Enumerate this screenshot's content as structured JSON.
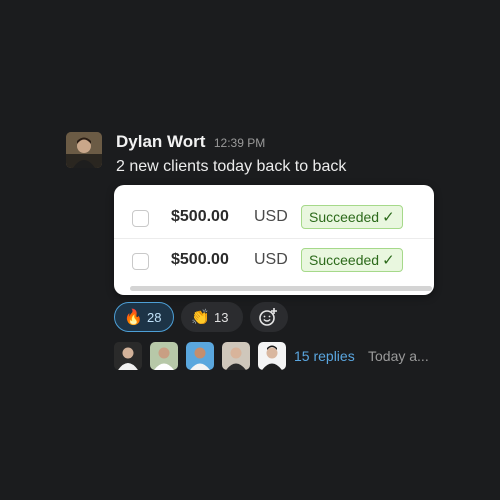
{
  "message": {
    "author": "Dylan Wort",
    "time": "12:39 PM",
    "text": "2 new clients today back to back"
  },
  "payments": [
    {
      "amount": "$500.00",
      "currency": "USD",
      "status": "Succeeded",
      "status_icon": "check-icon"
    },
    {
      "amount": "$500.00",
      "currency": "USD",
      "status": "Succeeded",
      "status_icon": "check-icon"
    }
  ],
  "reactions": [
    {
      "emoji": "🔥",
      "count": "28",
      "active": true
    },
    {
      "emoji": "👏",
      "count": "13",
      "active": false
    }
  ],
  "add_reaction_icon": "add-reaction-icon",
  "thread": {
    "replies": "15 replies",
    "last_reply": "Today a..."
  },
  "colors": {
    "background": "#1b1c1e",
    "link": "#5aa6e0",
    "success_bg": "#e9f7df",
    "success_border": "#a6d98a",
    "active_reaction_border": "#4d9fd6"
  }
}
